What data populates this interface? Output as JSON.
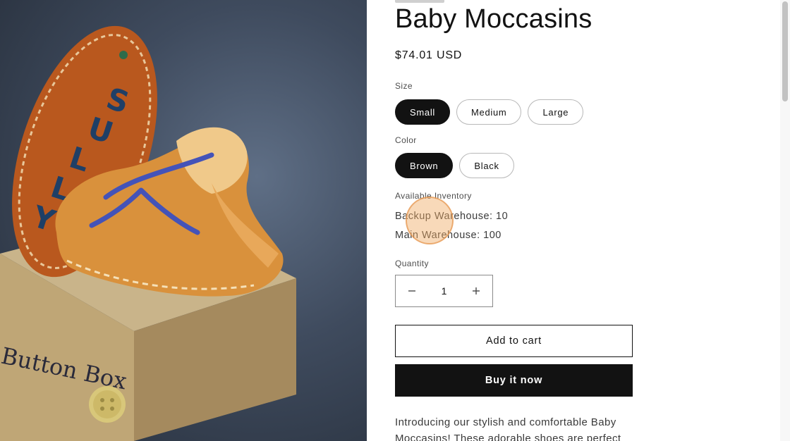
{
  "product": {
    "title": "Baby Moccasins",
    "price": "$74.01 USD",
    "image_alt": "Baby Moccasins product photo",
    "image_text": {
      "sole_lettering": "SULLY",
      "box_lettering": "Button Box"
    }
  },
  "options": {
    "size": {
      "label": "Size",
      "values": [
        "Small",
        "Medium",
        "Large"
      ],
      "selected": "Small"
    },
    "color": {
      "label": "Color",
      "values": [
        "Brown",
        "Black"
      ],
      "selected": "Brown"
    }
  },
  "inventory": {
    "label": "Available Inventory",
    "lines": [
      "Backup Warehouse: 10",
      "Main Warehouse: 100"
    ]
  },
  "quantity": {
    "label": "Quantity",
    "value": "1",
    "decrease_icon": "minus-icon",
    "increase_icon": "plus-icon"
  },
  "buttons": {
    "add_to_cart": "Add to cart",
    "buy_now": "Buy it now"
  },
  "description": "Introducing our stylish and comfortable Baby Moccasins! These adorable shoes are perfect for",
  "colors": {
    "primary": "#121212",
    "background": "#ffffff",
    "cursor_highlight": "#f0aa64"
  }
}
